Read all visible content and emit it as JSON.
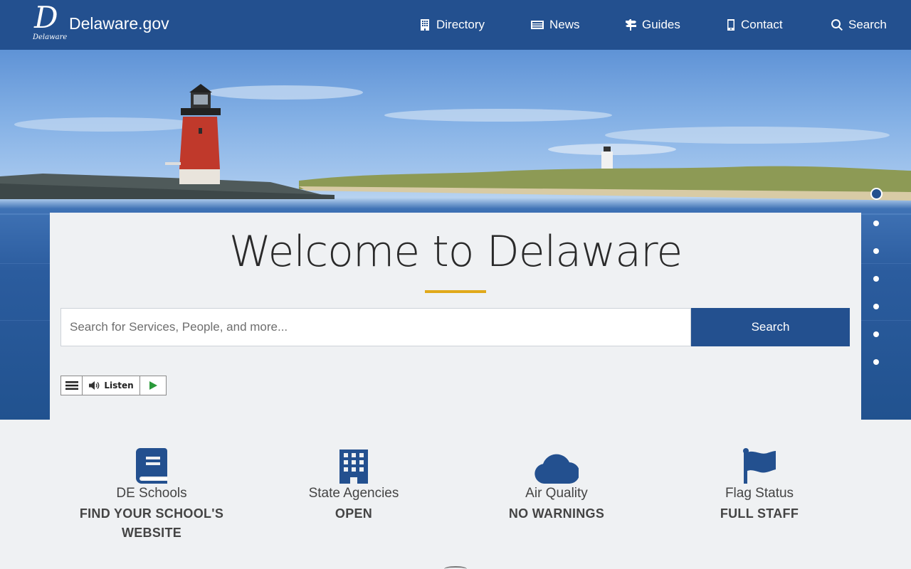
{
  "header": {
    "logo_mark": "D",
    "logo_subtext": "Delaware",
    "site_name": "Delaware.gov",
    "nav": [
      {
        "label": "Directory",
        "icon": "building-icon"
      },
      {
        "label": "News",
        "icon": "newspaper-icon"
      },
      {
        "label": "Guides",
        "icon": "signpost-icon"
      },
      {
        "label": "Contact",
        "icon": "mobile-phone-icon"
      },
      {
        "label": "Search",
        "icon": "search-icon"
      }
    ]
  },
  "hero": {
    "slide_count": 7,
    "active_slide": 1
  },
  "welcome": {
    "title": "Welcome to Delaware",
    "search_placeholder": "Search for Services, People, and more...",
    "search_value": "",
    "search_button": "Search",
    "listen_label": "Listen"
  },
  "tiles": [
    {
      "title": "DE Schools",
      "value": "FIND YOUR SCHOOL'S WEBSITE",
      "icon": "book-icon"
    },
    {
      "title": "State Agencies",
      "value": "OPEN",
      "icon": "building-icon"
    },
    {
      "title": "Air Quality",
      "value": "NO WARNINGS",
      "icon": "cloud-icon"
    },
    {
      "title": "Flag Status",
      "value": "FULL STAFF",
      "icon": "flag-icon"
    }
  ],
  "colors": {
    "brand_blue": "#23508f",
    "accent_gold": "#e0a91b",
    "page_bg": "#eff1f3"
  }
}
